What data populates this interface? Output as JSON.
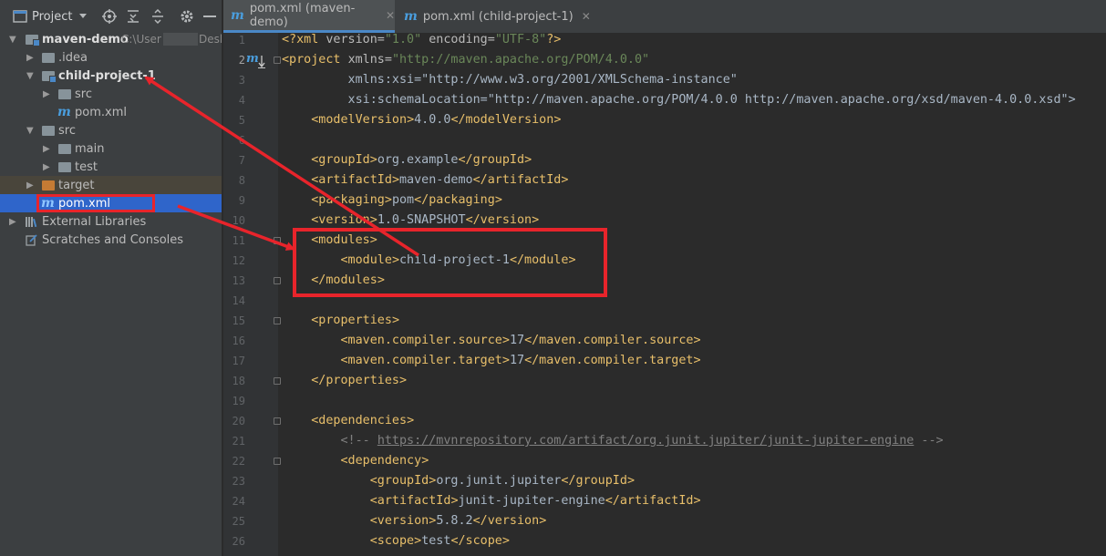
{
  "sidebar": {
    "toolbar": {
      "project_label": "Project"
    },
    "tree": [
      {
        "id": "maven-demo",
        "label": "maven-demo",
        "hint": "C:\\User",
        "hint_tail": "Desk"
      },
      {
        "id": "idea",
        "label": ".idea"
      },
      {
        "id": "child-project-1",
        "label": "child-project-1"
      },
      {
        "id": "child-src",
        "label": "src"
      },
      {
        "id": "child-pom",
        "label": "pom.xml"
      },
      {
        "id": "src",
        "label": "src"
      },
      {
        "id": "main",
        "label": "main"
      },
      {
        "id": "test",
        "label": "test"
      },
      {
        "id": "target",
        "label": "target"
      },
      {
        "id": "pom",
        "label": "pom.xml"
      },
      {
        "id": "external-libraries",
        "label": "External Libraries"
      },
      {
        "id": "scratches",
        "label": "Scratches and Consoles"
      }
    ]
  },
  "tabs": [
    {
      "label": "pom.xml (maven-demo)",
      "active": true
    },
    {
      "label": "pom.xml (child-project-1)",
      "active": false
    }
  ],
  "editor": {
    "gutter_marker": "m",
    "lines": [
      "<?xml version=\"1.0\" encoding=\"UTF-8\"?>",
      "<project xmlns=\"http://maven.apache.org/POM/4.0.0\"",
      "         xmlns:xsi=\"http://www.w3.org/2001/XMLSchema-instance\"",
      "         xsi:schemaLocation=\"http://maven.apache.org/POM/4.0.0 http://maven.apache.org/xsd/maven-4.0.0.xsd\">",
      "    <modelVersion>4.0.0</modelVersion>",
      "",
      "    <groupId>org.example</groupId>",
      "    <artifactId>maven-demo</artifactId>",
      "    <packaging>pom</packaging>",
      "    <version>1.0-SNAPSHOT</version>",
      "    <modules>",
      "        <module>child-project-1</module>",
      "    </modules>",
      "",
      "    <properties>",
      "        <maven.compiler.source>17</maven.compiler.source>",
      "        <maven.compiler.target>17</maven.compiler.target>",
      "    </properties>",
      "",
      "    <dependencies>",
      "        <!-- https://mvnrepository.com/artifact/org.junit.jupiter/junit-jupiter-engine -->",
      "        <dependency>",
      "            <groupId>org.junit.jupiter</groupId>",
      "            <artifactId>junit-jupiter-engine</artifactId>",
      "            <version>5.8.2</version>",
      "            <scope>test</scope>"
    ]
  },
  "icons": {
    "toolbar": [
      "project-view-icon",
      "dropdown-icon",
      "locate-icon",
      "expand-all-icon",
      "collapse-all-icon",
      "gear-icon",
      "hide-icon"
    ],
    "maven_file": "maven-m-icon"
  },
  "colors": {
    "annotation_red": "#e8242b",
    "selection_blue": "#2f65ca",
    "xml_tag": "#e8bf6a",
    "xml_string": "#6a8759"
  }
}
